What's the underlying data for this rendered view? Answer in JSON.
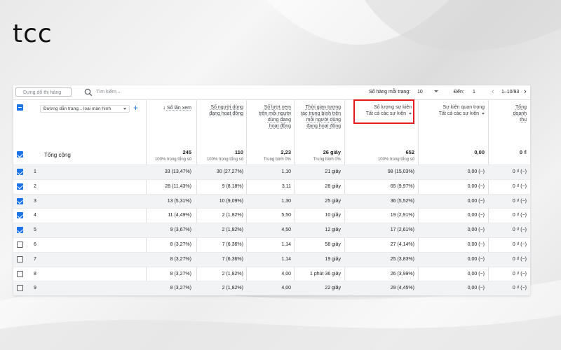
{
  "logo": "tcc",
  "toolbar": {
    "dimension_placeholder": "Dựng dổ thị hàng",
    "search_placeholder": "Tìm kiếm...",
    "rows_per_page_label": "Số hàng mỗi trang:",
    "rows_per_page_value": "10",
    "goto_label": "Đến:",
    "goto_value": "1",
    "pagination": "1–10/93"
  },
  "dimension": {
    "label": "Đường dẫn trang... loại màn hình"
  },
  "columns": [
    {
      "label": "Số lần xem",
      "sorted": true
    },
    {
      "label": "Số người dùng đang hoạt động"
    },
    {
      "label": "Số lượt xem trên mỗi người dùng đang hoạt động"
    },
    {
      "label": "Thời gian tương tác trung bình trên mỗi người dùng đang hoạt động"
    },
    {
      "label": "Số lượng sự kiện",
      "sub": "Tất cả các sự kiện",
      "highlighted": true
    },
    {
      "label": "Sự kiện quan trọng",
      "sub": "Tất cả các sự kiện"
    },
    {
      "label": "Tổng doanh thu"
    }
  ],
  "totals": {
    "label": "Tổng cộng",
    "values": [
      {
        "big": "245",
        "small": "100% trong tổng số"
      },
      {
        "big": "110",
        "small": "100% trong tổng số"
      },
      {
        "big": "2,23",
        "small": "Trung bình 0%"
      },
      {
        "big": "26 giây",
        "small": "Trung bình 0%"
      },
      {
        "big": "652",
        "small": "100% trong tổng số"
      },
      {
        "big": "0,00",
        "small": ""
      },
      {
        "big": "0 ₫",
        "small": ""
      }
    ]
  },
  "rows": [
    {
      "rank": "1",
      "checked": true,
      "cells": [
        "33 (13,47%)",
        "30 (27,27%)",
        "1,10",
        "21 giây",
        "98 (15,03%)",
        "0,00 (−)",
        "0 ₫ (−)"
      ]
    },
    {
      "rank": "2",
      "checked": true,
      "cells": [
        "28 (11,43%)",
        "9 (8,18%)",
        "3,11",
        "28 giây",
        "65 (9,97%)",
        "0,00 (−)",
        "0 ₫ (−)"
      ]
    },
    {
      "rank": "3",
      "checked": true,
      "cells": [
        "13 (5,31%)",
        "10 (9,09%)",
        "1,30",
        "25 giây",
        "36 (5,52%)",
        "0,00 (−)",
        "0 ₫ (−)"
      ]
    },
    {
      "rank": "4",
      "checked": true,
      "cells": [
        "11 (4,49%)",
        "2 (1,82%)",
        "5,50",
        "10 giây",
        "19 (2,91%)",
        "0,00 (−)",
        "0 ₫ (−)"
      ]
    },
    {
      "rank": "5",
      "checked": true,
      "cells": [
        "9 (3,67%)",
        "2 (1,82%)",
        "4,50",
        "12 giây",
        "17 (2,61%)",
        "0,00 (−)",
        "0 ₫ (−)"
      ]
    },
    {
      "rank": "6",
      "checked": false,
      "cells": [
        "8 (3,27%)",
        "7 (6,36%)",
        "1,14",
        "58 giây",
        "27 (4,14%)",
        "0,00 (−)",
        "0 ₫ (−)"
      ]
    },
    {
      "rank": "7",
      "checked": false,
      "cells": [
        "8 (3,27%)",
        "7 (6,36%)",
        "1,14",
        "19 giây",
        "25 (3,83%)",
        "0,00 (−)",
        "0 ₫ (−)"
      ]
    },
    {
      "rank": "8",
      "checked": false,
      "cells": [
        "8 (3,27%)",
        "2 (1,82%)",
        "4,00",
        "1 phút 36 giây",
        "26 (3,99%)",
        "0,00 (−)",
        "0 ₫ (−)"
      ]
    },
    {
      "rank": "9",
      "checked": false,
      "cells": [
        "8 (3,27%)",
        "2 (1,82%)",
        "4,00",
        "22 giây",
        "29 (4,45%)",
        "0,00 (−)",
        "0 ₫ (−)"
      ]
    }
  ]
}
